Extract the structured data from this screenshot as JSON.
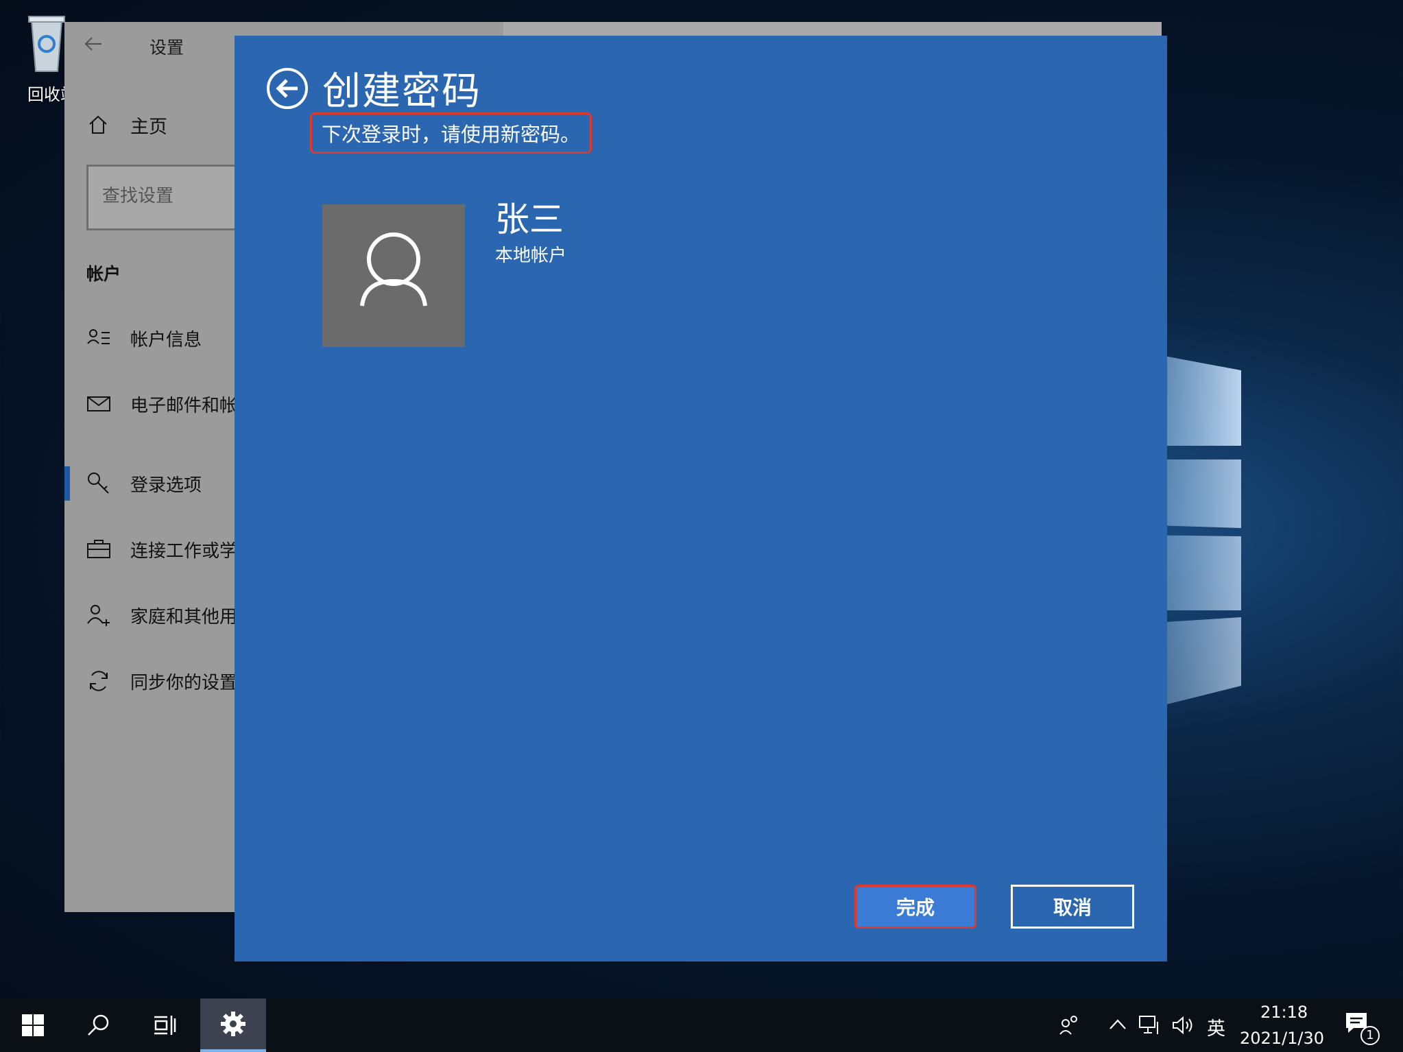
{
  "desktop": {
    "recycle_bin_label": "回收站"
  },
  "settings_window": {
    "title": "设置",
    "home_label": "主页",
    "search_placeholder": "查找设置",
    "section_title": "帐户",
    "nav_items": [
      {
        "label": "帐户信息",
        "icon": "account-info-icon"
      },
      {
        "label": "电子邮件和帐户",
        "icon": "mail-icon"
      },
      {
        "label": "登录选项",
        "icon": "key-icon",
        "selected": true
      },
      {
        "label": "连接工作或学校帐户",
        "icon": "briefcase-icon"
      },
      {
        "label": "家庭和其他用户",
        "icon": "add-person-icon"
      },
      {
        "label": "同步你的设置",
        "icon": "sync-icon"
      }
    ]
  },
  "dialog": {
    "title": "创建密码",
    "subtitle": "下次登录时，请使用新密码。",
    "user": {
      "name": "张三",
      "account_type": "本地帐户"
    },
    "buttons": {
      "done": "完成",
      "cancel": "取消"
    },
    "colors": {
      "background": "#2b66b1",
      "highlight_box": "#e0392b",
      "done_button": "#3a7bd5"
    }
  },
  "taskbar": {
    "ime_label": "英",
    "clock_time": "21:18",
    "clock_date": "2021/1/30",
    "notification_count": "1"
  }
}
